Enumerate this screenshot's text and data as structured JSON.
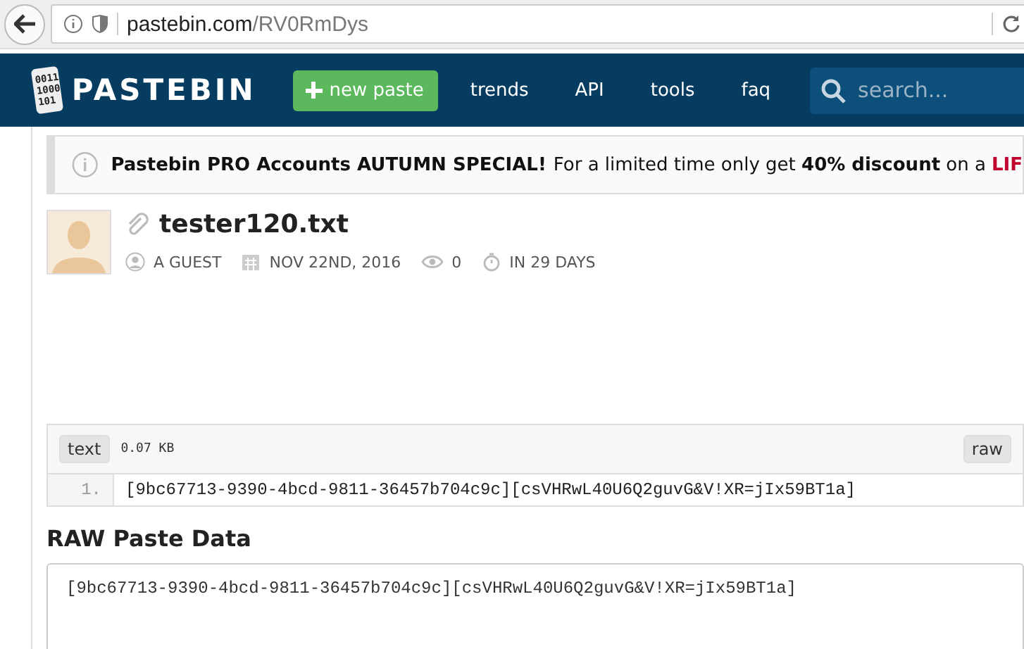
{
  "browser": {
    "url_host": "pastebin.com",
    "url_path": "/RV0RmDys"
  },
  "nav": {
    "logo_digits": [
      "0011",
      "1000",
      "101"
    ],
    "brand": "PASTEBIN",
    "new_paste": "new paste",
    "links": [
      "trends",
      "API",
      "tools",
      "faq"
    ],
    "search": {
      "placeholder": "search..."
    }
  },
  "banner": {
    "title": "Pastebin PRO Accounts AUTUMN SPECIAL!",
    "body": "For a limited time only get **40% discount** on a",
    "link": "LIF"
  },
  "paste": {
    "title": "tester120.txt",
    "author": "A GUEST",
    "date": "NOV 22ND, 2016",
    "views": "0",
    "expires": "IN 29 DAYS"
  },
  "code": {
    "syntax": "text",
    "size": "0.07 KB",
    "raw": "raw",
    "lines": [
      {
        "number": "1.",
        "text": "[9bc67713-9390-4bcd-9811-36457b704c9c][csVHRwL40U6Q2guvG&V!XR=jIx59BT1a]"
      }
    ]
  },
  "raw_section": {
    "heading": "RAW Paste Data",
    "text": "[9bc67713-9390-4bcd-9811-36457b704c9c][csVHRwL40U6Q2guvG&V!XR=jIx59BT1a]"
  }
}
